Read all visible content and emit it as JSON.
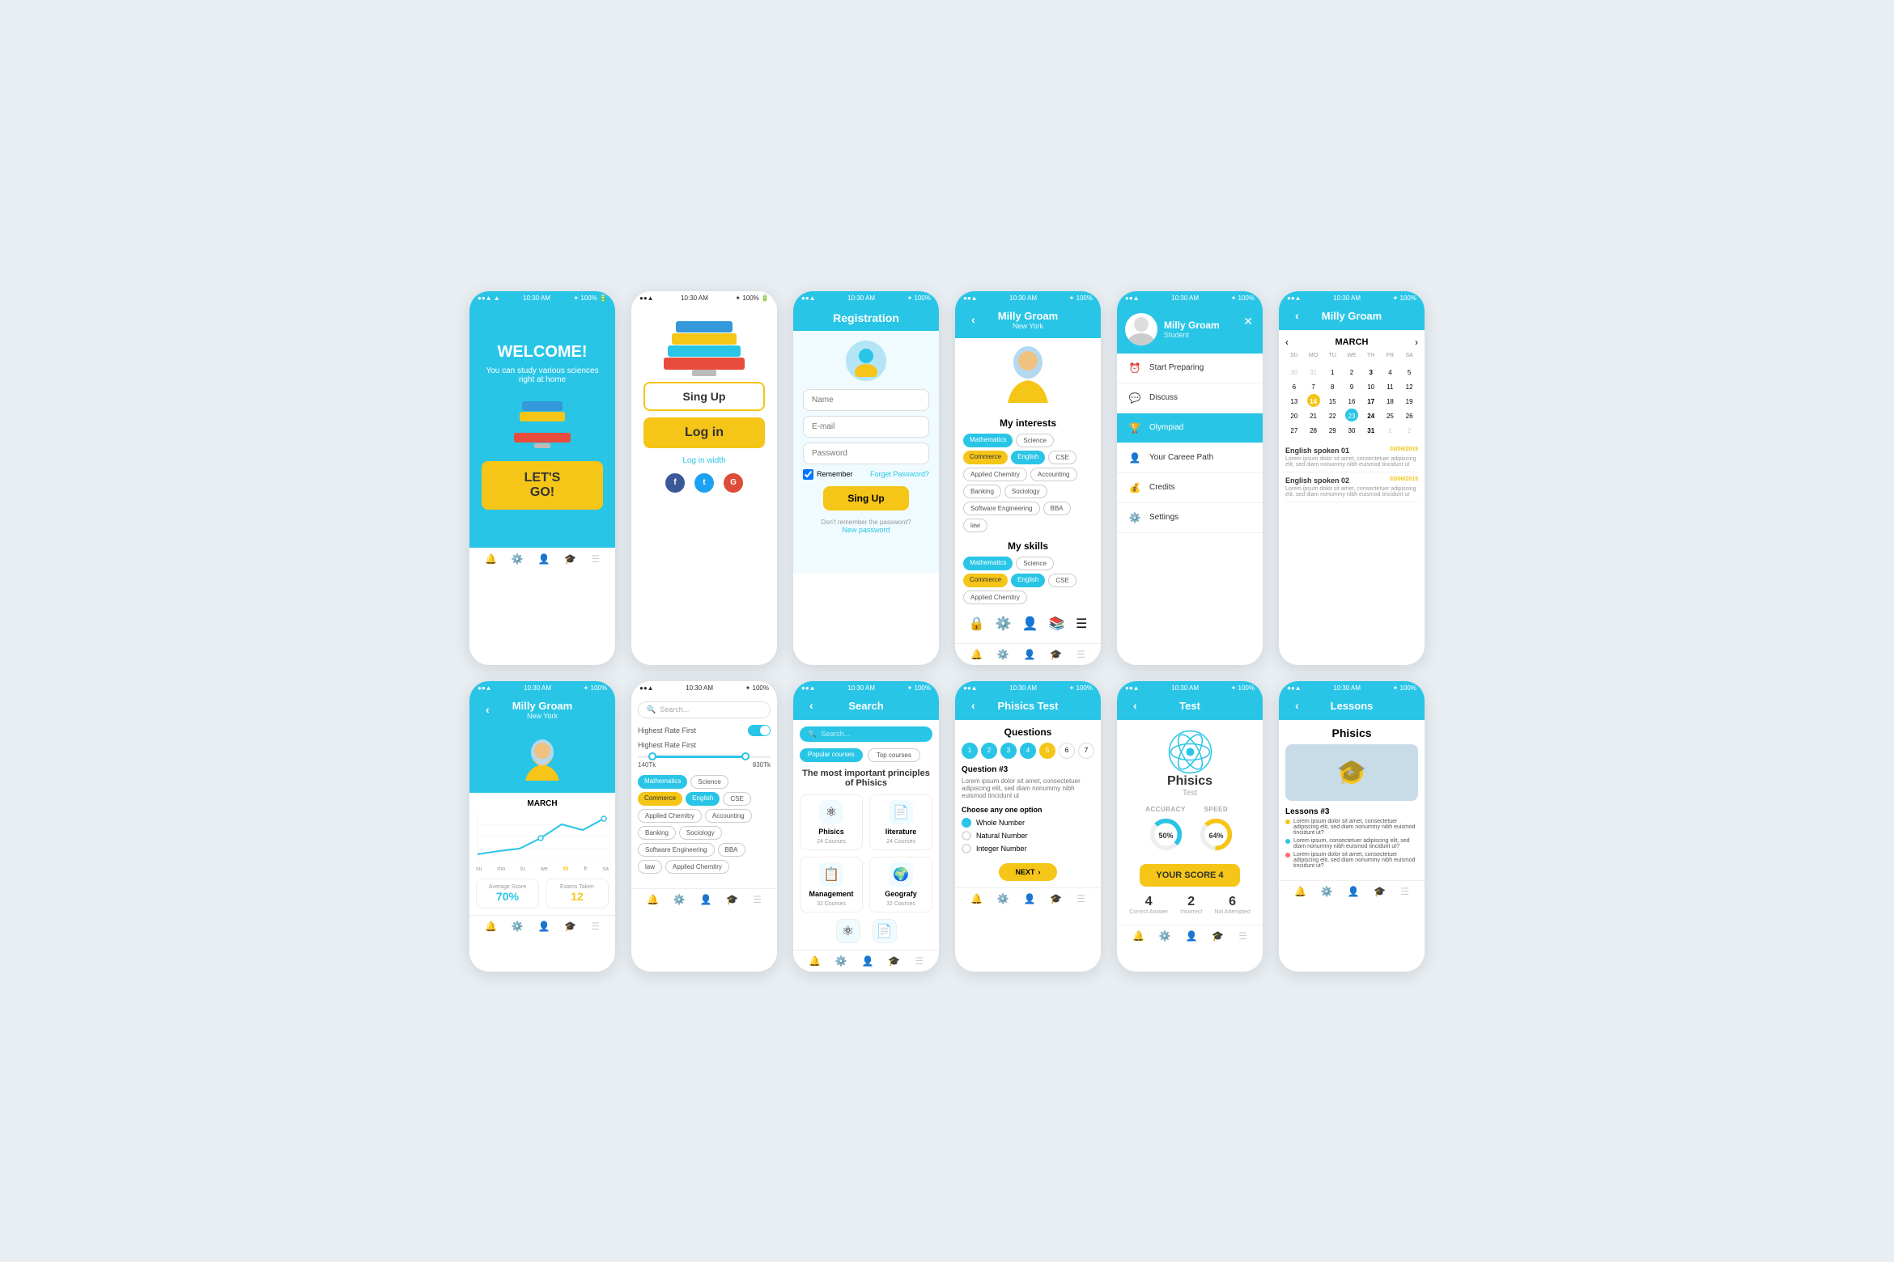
{
  "app": {
    "status_bar": "10:30 AM",
    "battery": "100%",
    "signal": "●●●"
  },
  "screen1": {
    "title": "WELCOME!",
    "subtitle": "You can study various sciences right at home",
    "cta": "LET'S GO!"
  },
  "screen2": {
    "signup_label": "Sing Up",
    "login_label": "Log in",
    "login_width": "Log in width"
  },
  "screen3": {
    "header": "Registration",
    "name_placeholder": "Name",
    "email_placeholder": "E-mail",
    "password_placeholder": "Password",
    "remember_label": "Remember",
    "forget_label": "Forget Password?",
    "signup_btn": "Sing Up",
    "footer_text": "Don't remember the password?",
    "new_password": "New password"
  },
  "screen4": {
    "header_name": "Milly Groam",
    "header_sub": "New York",
    "interests_title": "My interests",
    "interests_tags": [
      "Mathematics",
      "Science",
      "Commerce",
      "English",
      "CSE",
      "Applied Chemitry",
      "Accounting",
      "Banking",
      "Sociology",
      "Software Engineering",
      "BBA",
      "law"
    ],
    "skills_title": "My skills",
    "skills_tags": [
      "Mathematics",
      "Science",
      "Commerce",
      "English",
      "CSE",
      "Applied Chemitry"
    ]
  },
  "screen5": {
    "header_name": "Milly Groam",
    "header_role": "Student",
    "menu": [
      {
        "icon": "⏰",
        "label": "Start Preparing"
      },
      {
        "icon": "💬",
        "label": "Discuss"
      },
      {
        "icon": "🏆",
        "label": "Olympiad"
      },
      {
        "icon": "👤",
        "label": "Your Careee Path"
      },
      {
        "icon": "💰",
        "label": "Credits"
      },
      {
        "icon": "⚙️",
        "label": "Settings"
      }
    ]
  },
  "screen6": {
    "header_name": "Milly Groam",
    "month": "MARCH",
    "day_headers": [
      "SU",
      "MO",
      "TU",
      "WE",
      "TH",
      "FR",
      "SA"
    ],
    "days": [
      {
        "d": "30",
        "prev": true
      },
      {
        "d": "31",
        "prev": true
      },
      {
        "d": "1"
      },
      {
        "d": "2"
      },
      {
        "d": "3",
        "bold": true
      },
      {
        "d": "4"
      },
      {
        "d": "5"
      },
      {
        "d": "6"
      },
      {
        "d": "7"
      },
      {
        "d": "8"
      },
      {
        "d": "9"
      },
      {
        "d": "10"
      },
      {
        "d": "11"
      },
      {
        "d": "12"
      },
      {
        "d": "13"
      },
      {
        "d": "14",
        "today": true
      },
      {
        "d": "15"
      },
      {
        "d": "16"
      },
      {
        "d": "17",
        "bold": true
      },
      {
        "d": "18"
      },
      {
        "d": "19"
      },
      {
        "d": "20"
      },
      {
        "d": "21"
      },
      {
        "d": "22"
      },
      {
        "d": "23",
        "highlighted": true
      },
      {
        "d": "24",
        "bold": true
      },
      {
        "d": "25"
      },
      {
        "d": "26"
      },
      {
        "d": "27"
      },
      {
        "d": "28"
      },
      {
        "d": "29"
      },
      {
        "d": "30"
      },
      {
        "d": "31",
        "bold": true
      },
      {
        "d": "1",
        "next": true
      },
      {
        "d": "2",
        "next": true
      }
    ],
    "news": [
      {
        "title": "English spoken 01",
        "date": "03/06/2019",
        "desc": "Lorem ipsum dolor sit amet, consectetuer adipiscing elit, sed diam nonummy nibh euismod tincidunt ut"
      },
      {
        "title": "English spoken 02",
        "date": "03/06/2019",
        "desc": "Lorem ipsum dolor sit amet, consectetuer adipiscing elit, sed diam nonummy nibh euismod tincidunt ut"
      }
    ]
  },
  "screen7": {
    "header_name": "Milly Groam",
    "header_sub": "New York",
    "month": "MARCH",
    "chart_labels": [
      "su",
      "mo",
      "tu",
      "we",
      "th",
      "fr",
      "sa"
    ],
    "chart_values": [
      50,
      80,
      100,
      180,
      250,
      200,
      350
    ],
    "chart_max": 400,
    "chart_ticks": [
      "400",
      "300",
      "200",
      "100",
      "0"
    ],
    "avg_score_label": "Average Score",
    "avg_score_value": "70%",
    "exams_taken_label": "Exams Taken",
    "exams_taken_value": "12"
  },
  "screen8": {
    "search_placeholder": "Search...",
    "filter1_label": "Highest Rate First",
    "filter2_label": "Highest Rate First",
    "range_min": "140Tk",
    "range_max": "830Tk",
    "tags": [
      "Mathematics",
      "Science",
      "Commerce",
      "English",
      "CSE",
      "Applied Chemitry",
      "Accounting",
      "Banking",
      "Sociology",
      "Software Engineering",
      "BBA",
      "law",
      "Applied Chemitry"
    ]
  },
  "screen9": {
    "header": "Search",
    "search_placeholder": "Search...",
    "tab1": "Popular courses",
    "tab2": "Top courses",
    "featured_title": "The most important principles of Phisics",
    "courses": [
      {
        "name": "Phisics",
        "count": "24 Courses",
        "icon": "⚛"
      },
      {
        "name": "literature",
        "count": "24 Courses",
        "icon": "📄"
      },
      {
        "name": "Management",
        "count": "32 Courses",
        "icon": "📋"
      },
      {
        "name": "Geografy",
        "count": "32 Courses",
        "icon": "🌍"
      }
    ]
  },
  "screen10": {
    "header": "Phisics Test",
    "section_title": "Questions",
    "question_numbers": [
      1,
      2,
      3,
      4,
      5,
      6,
      7
    ],
    "active_question": 5,
    "done_questions": [
      1,
      2,
      3,
      4
    ],
    "current_question": "Question #3",
    "question_text": "Lorem ipsum dolor sit amet, consectetuer adipiscing elit, sed diam nonummy nibh euismod tincidunt ut",
    "choose_label": "Choose any one option",
    "options": [
      {
        "label": "Whole Number",
        "selected": true
      },
      {
        "label": "Natural Number",
        "selected": false
      },
      {
        "label": "Integer Number",
        "selected": false
      }
    ],
    "next_btn": "NEXT"
  },
  "screen11": {
    "header": "Test",
    "subject": "Phisics",
    "subject_sub": "Test",
    "accuracy_label": "ACCURACY",
    "speed_label": "SPEED",
    "accuracy_val": 50,
    "speed_val": 64,
    "score_label": "YOUR SCORE 4",
    "correct_label": "Correct Answer",
    "correct_val": "4",
    "incorrect_label": "Incorrect",
    "incorrect_val": "2",
    "not_attempted_label": "Not Attempted",
    "not_attempted_val": "6"
  },
  "screen12": {
    "header": "Lessons",
    "subject": "Phisics",
    "lesson_title": "Lessons #3",
    "lesson_items": [
      "Lorem ipsum dolor sit amet, consectetuer adipiscing elit, sed diam nonummy nibh euismod tincidunt ut?",
      "Lorem ipsum, consectetuer adipiscing elit, sed diam nonummy nibh euismod tincidunt ut?",
      "Lorem ipsum dolor sit amet, consectetuer adipiscing elit, sed diam nonummy nibh euismod tincidunt ut?"
    ]
  }
}
